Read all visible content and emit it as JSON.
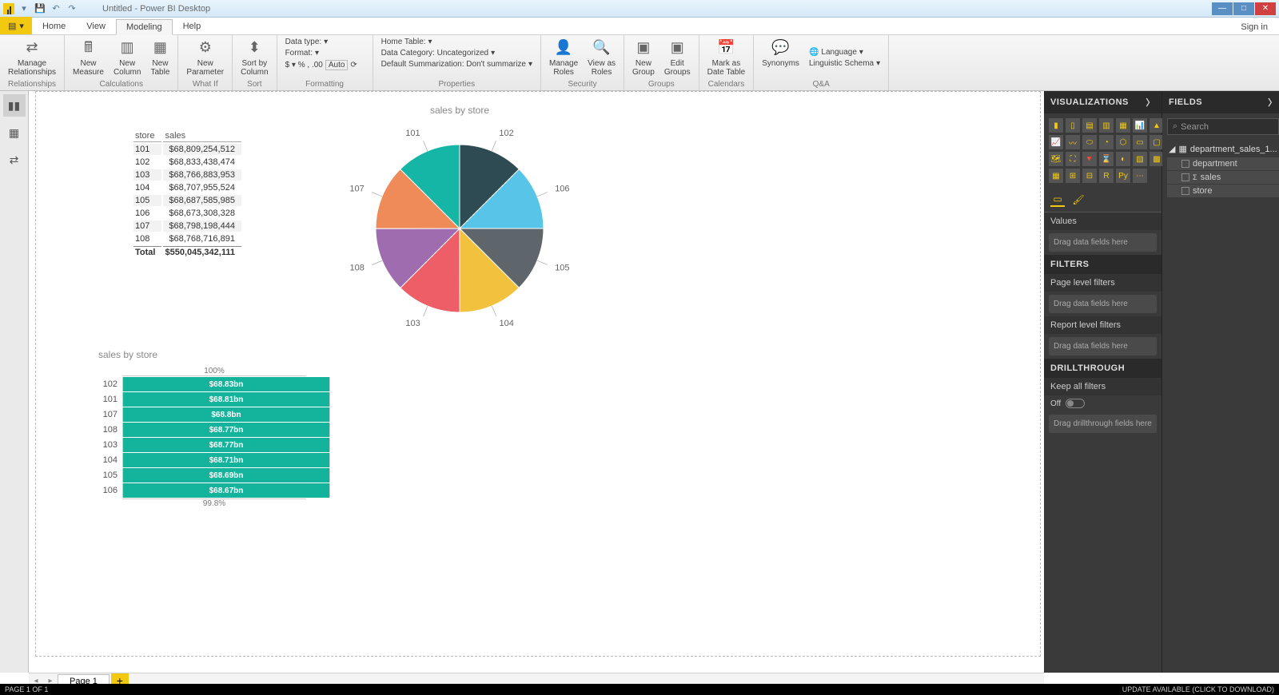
{
  "app": {
    "title": "Untitled - Power BI Desktop",
    "signin": "Sign in"
  },
  "ribbon_tabs": {
    "file": "File",
    "home": "Home",
    "view": "View",
    "modeling": "Modeling",
    "help": "Help"
  },
  "ribbon": {
    "relationships": {
      "manage": "Manage\nRelationships",
      "group": "Relationships"
    },
    "calc": {
      "measure": "New\nMeasure",
      "column": "New\nColumn",
      "table": "New\nTable",
      "group": "Calculations"
    },
    "whatif": {
      "param": "New\nParameter",
      "group": "What If"
    },
    "sort": {
      "sort": "Sort by\nColumn",
      "group": "Sort"
    },
    "formatting": {
      "datatype": "Data type:",
      "format": "Format:",
      "currency": "$ - %",
      "decimals": "Auto",
      "group": "Formatting"
    },
    "properties": {
      "hometable": "Home Table:",
      "datacategory": "Data Category: Uncategorized",
      "defaultsum": "Default Summarization: Don't summarize",
      "group": "Properties"
    },
    "security": {
      "manage": "Manage\nRoles",
      "view": "View as\nRoles",
      "group": "Security"
    },
    "groups": {
      "new": "New\nGroup",
      "edit": "Edit\nGroups",
      "group": "Groups"
    },
    "calendars": {
      "mark": "Mark as\nDate Table",
      "group": "Calendars"
    },
    "qa": {
      "syn": "Synonyms",
      "lang": "Language",
      "schema": "Linguistic Schema",
      "group": "Q&A"
    }
  },
  "canvas": {
    "pie_title": "sales by store",
    "funnel_title": "sales by store",
    "funnel_top": "100%",
    "funnel_bot": "99.8%"
  },
  "chart_data": [
    {
      "type": "table",
      "columns": [
        "store",
        "sales"
      ],
      "rows": [
        [
          "101",
          "$68,809,254,512"
        ],
        [
          "102",
          "$68,833,438,474"
        ],
        [
          "103",
          "$68,766,883,953"
        ],
        [
          "104",
          "$68,707,955,524"
        ],
        [
          "105",
          "$68,687,585,985"
        ],
        [
          "106",
          "$68,673,308,328"
        ],
        [
          "107",
          "$68,798,198,444"
        ],
        [
          "108",
          "$68,768,716,891"
        ]
      ],
      "total": [
        "Total",
        "$550,045,342,111"
      ]
    },
    {
      "type": "pie",
      "title": "sales by store",
      "categories": [
        "101",
        "102",
        "103",
        "104",
        "105",
        "106",
        "107",
        "108"
      ],
      "values": [
        68809254512,
        68833438474,
        68766883953,
        68707955524,
        68687585985,
        68673308328,
        68798198444,
        68768716891
      ],
      "colors": [
        "#15b6a6",
        "#2e4a52",
        "#ee5e66",
        "#f2c23e",
        "#5e666b",
        "#58c5e8",
        "#ef8b58",
        "#a06cb0"
      ]
    },
    {
      "type": "bar",
      "title": "sales by store",
      "orientation": "horizontal",
      "categories": [
        "102",
        "101",
        "107",
        "108",
        "103",
        "104",
        "105",
        "106"
      ],
      "labels": [
        "$68.83bn",
        "$68.81bn",
        "$68.8bn",
        "$68.77bn",
        "$68.77bn",
        "$68.71bn",
        "$68.69bn",
        "$68.67bn"
      ],
      "values": [
        68.83,
        68.81,
        68.8,
        68.77,
        68.77,
        68.71,
        68.69,
        68.67
      ],
      "pct_of_max": [
        100,
        99.97,
        99.96,
        99.91,
        99.9,
        99.83,
        99.8,
        99.77
      ],
      "axis_top": "100%",
      "axis_bottom": "99.8%"
    }
  ],
  "vis_panel": {
    "header": "VISUALIZATIONS",
    "values": "Values",
    "drag": "Drag data fields here",
    "filters": "FILTERS",
    "pagefilters": "Page level filters",
    "reportfilters": "Report level filters",
    "drill": "DRILLTHROUGH",
    "keepall": "Keep all filters",
    "off": "Off",
    "dragdrill": "Drag drillthrough fields here"
  },
  "fields_panel": {
    "header": "FIELDS",
    "search": "Search",
    "table": "department_sales_1...",
    "f1": "department",
    "f2": "sales",
    "f3": "store"
  },
  "pagetabs": {
    "page1": "Page 1"
  },
  "status": {
    "left": "PAGE 1 OF 1",
    "right": "UPDATE AVAILABLE (CLICK TO DOWNLOAD)"
  }
}
